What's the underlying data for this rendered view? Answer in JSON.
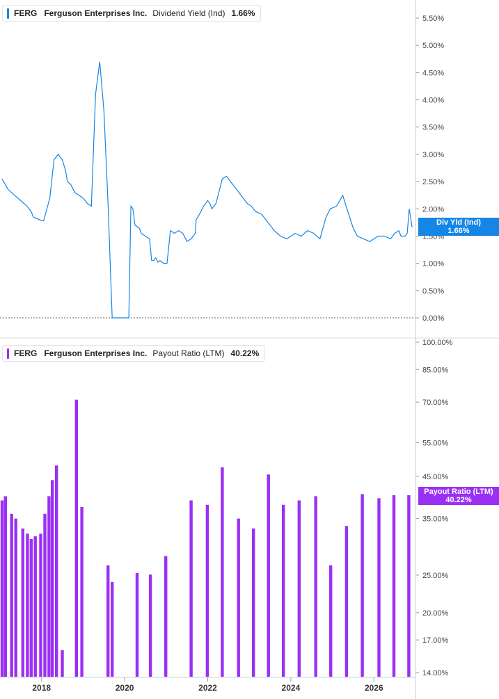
{
  "panels": {
    "top": {
      "ticker": "FERG",
      "company": "Ferguson Enterprises Inc.",
      "metric": "Dividend Yield (Ind)",
      "value": "1.66%",
      "tag_label": "Div Yld (Ind)",
      "tag_value": "1.66%",
      "color": "#1585e6"
    },
    "bottom": {
      "ticker": "FERG",
      "company": "Ferguson Enterprises Inc.",
      "metric": "Payout Ratio (LTM)",
      "value": "40.22%",
      "tag_label": "Payout Ratio (LTM)",
      "tag_value": "40.22%",
      "color": "#9b30f5"
    }
  },
  "chart_data": [
    {
      "type": "line",
      "series": [
        {
          "name": "Dividend Yield (Ind)",
          "x": [
            2017.05,
            2017.2,
            2017.35,
            2017.5,
            2017.65,
            2017.75,
            2017.8,
            2017.95,
            2018.05,
            2018.2,
            2018.3,
            2018.4,
            2018.5,
            2018.58,
            2018.62,
            2018.7,
            2018.8,
            2018.9,
            2019.0,
            2019.1,
            2019.2,
            2019.3,
            2019.4,
            2019.5,
            2019.6,
            2019.7,
            2019.75,
            2019.8,
            2019.85,
            2019.9,
            2019.95,
            2020.0,
            2020.1,
            2020.15,
            2020.2,
            2020.25,
            2020.35,
            2020.4,
            2020.5,
            2020.6,
            2020.65,
            2020.7,
            2020.72,
            2020.75,
            2020.8,
            2020.85,
            2020.9,
            2020.95,
            2021.0,
            2021.02,
            2021.1,
            2021.2,
            2021.3,
            2021.4,
            2021.5,
            2021.6,
            2021.7,
            2021.72,
            2021.8,
            2021.9,
            2022.0,
            2022.05,
            2022.1,
            2022.2,
            2022.3,
            2022.35,
            2022.45,
            2022.55,
            2022.65,
            2022.75,
            2022.85,
            2022.95,
            2023.05,
            2023.15,
            2023.3,
            2023.45,
            2023.6,
            2023.75,
            2023.9,
            2024.0,
            2024.1,
            2024.25,
            2024.4,
            2024.55,
            2024.7,
            2024.85,
            2024.95,
            2025.1,
            2025.25,
            2025.35,
            2025.5,
            2025.6,
            2025.75,
            2025.9,
            2026.0,
            2026.1,
            2026.25,
            2026.4,
            2026.5,
            2026.6,
            2026.65,
            2026.75,
            2026.8,
            2026.85,
            2026.92
          ],
          "y": [
            2.55,
            2.35,
            2.25,
            2.15,
            2.05,
            1.95,
            1.85,
            1.8,
            1.78,
            2.2,
            2.9,
            3.0,
            2.9,
            2.7,
            2.5,
            2.45,
            2.3,
            2.25,
            2.2,
            2.1,
            2.05,
            4.1,
            4.7,
            3.8,
            2.1,
            0.0,
            0.0,
            0.0,
            0.0,
            0.0,
            0.0,
            0.0,
            0.0,
            2.05,
            2.0,
            1.7,
            1.65,
            1.55,
            1.5,
            1.45,
            1.05,
            1.05,
            1.08,
            1.1,
            1.02,
            1.05,
            1.02,
            1.0,
            1.0,
            1.0,
            1.6,
            1.55,
            1.6,
            1.55,
            1.4,
            1.45,
            1.55,
            1.8,
            1.9,
            2.05,
            2.15,
            2.1,
            2.0,
            2.1,
            2.4,
            2.55,
            2.6,
            2.5,
            2.4,
            2.3,
            2.2,
            2.1,
            2.05,
            1.95,
            1.9,
            1.75,
            1.6,
            1.5,
            1.45,
            1.5,
            1.55,
            1.5,
            1.6,
            1.55,
            1.45,
            1.85,
            2.0,
            2.05,
            2.25,
            2.0,
            1.65,
            1.5,
            1.45,
            1.4,
            1.45,
            1.5,
            1.5,
            1.45,
            1.55,
            1.6,
            1.5,
            1.5,
            1.55,
            2.0,
            1.66
          ]
        }
      ],
      "ylim": [
        0,
        5.5
      ],
      "yticks": [
        "0.00%",
        "0.50%",
        "1.00%",
        "1.50%",
        "2.00%",
        "2.50%",
        "3.00%",
        "3.50%",
        "4.00%",
        "4.50%",
        "5.00%",
        "5.50%"
      ],
      "ytick_values": [
        0,
        0.5,
        1.0,
        1.5,
        2.0,
        2.5,
        3.0,
        3.5,
        4.0,
        4.5,
        5.0,
        5.5
      ]
    },
    {
      "type": "bar",
      "scale": "log",
      "series": [
        {
          "name": "Payout Ratio (LTM)",
          "x": [
            2017.05,
            2017.13,
            2017.28,
            2017.38,
            2017.55,
            2017.66,
            2017.75,
            2017.85,
            2017.98,
            2018.08,
            2018.18,
            2018.26,
            2018.36,
            2018.5,
            2018.84,
            2018.97,
            2019.6,
            2019.7,
            2020.3,
            2020.62,
            2020.99,
            2021.6,
            2021.99,
            2022.35,
            2022.74,
            2023.1,
            2023.46,
            2023.82,
            2024.2,
            2024.6,
            2024.96,
            2025.34,
            2025.72,
            2026.12,
            2026.48,
            2026.84
          ],
          "values": [
            39.0,
            40.0,
            36.0,
            35.0,
            33.0,
            32.0,
            31.0,
            31.5,
            32.0,
            36.0,
            40.0,
            44.0,
            48.0,
            16.0,
            71.0,
            37.5,
            26.5,
            24.0,
            25.3,
            25.1,
            28.0,
            39.0,
            38.0,
            47.5,
            35.0,
            33.0,
            45.5,
            38.0,
            39.0,
            40.0,
            26.5,
            33.5,
            40.5,
            39.5,
            40.22,
            40.22
          ]
        }
      ],
      "ylim": [
        14,
        100
      ],
      "yticks": [
        "14.00%",
        "17.00%",
        "20.00%",
        "25.00%",
        "35.00%",
        "45.00%",
        "55.00%",
        "70.00%",
        "85.00%",
        "100.00%"
      ],
      "ytick_values": [
        14,
        17,
        20,
        25,
        35,
        45,
        55,
        70,
        85,
        100
      ]
    }
  ],
  "x_axis": {
    "xlim": [
      2017.0,
      2027.0
    ],
    "ticks": [
      "2018",
      "2020",
      "2022",
      "2024",
      "2026"
    ],
    "tick_values": [
      2018,
      2020,
      2022,
      2024,
      2026
    ]
  }
}
